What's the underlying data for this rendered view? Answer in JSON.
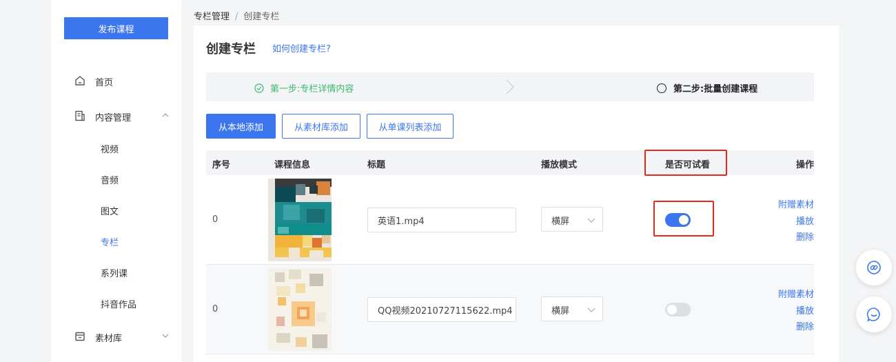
{
  "sidebar": {
    "publish_label": "发布课程",
    "items": [
      {
        "label": "首页",
        "icon": "home-icon"
      },
      {
        "label": "内容管理",
        "icon": "document-icon"
      },
      {
        "label": "素材库",
        "icon": "folder-icon"
      }
    ],
    "content_sub": [
      "视频",
      "音频",
      "图文",
      "专栏",
      "系列课",
      "抖音作品"
    ],
    "active_sub": "专栏"
  },
  "breadcrumb": {
    "parent": "专栏管理",
    "separator": "/",
    "current": "创建专栏"
  },
  "page": {
    "title": "创建专栏",
    "help_link": "如何创建专栏?"
  },
  "steps": {
    "step1": "第一步:专栏详情内容",
    "step2": "第二步:批量创建课程"
  },
  "buttons": {
    "local_add": "从本地添加",
    "library_add": "从素材库添加",
    "single_list_add": "从单课列表添加"
  },
  "table": {
    "headers": {
      "index": "序号",
      "course_info": "课程信息",
      "title": "标题",
      "play_mode": "播放模式",
      "trial": "是否可试看",
      "actions": "操作"
    },
    "rows": [
      {
        "index": "0",
        "title": "英语1.mp4",
        "play_mode": "横屏",
        "trial_enabled": true,
        "actions": [
          "附赠素材",
          "播放",
          "删除"
        ]
      },
      {
        "index": "0",
        "title": "QQ视频20210727115622.mp4",
        "play_mode": "横屏",
        "trial_enabled": false,
        "actions": [
          "附赠素材",
          "播放",
          "删除"
        ]
      }
    ]
  },
  "colors": {
    "primary": "#3c76ef",
    "success": "#3dba6a",
    "highlight": "#e5281a"
  },
  "float_buttons": [
    "link-icon",
    "chat-icon"
  ]
}
